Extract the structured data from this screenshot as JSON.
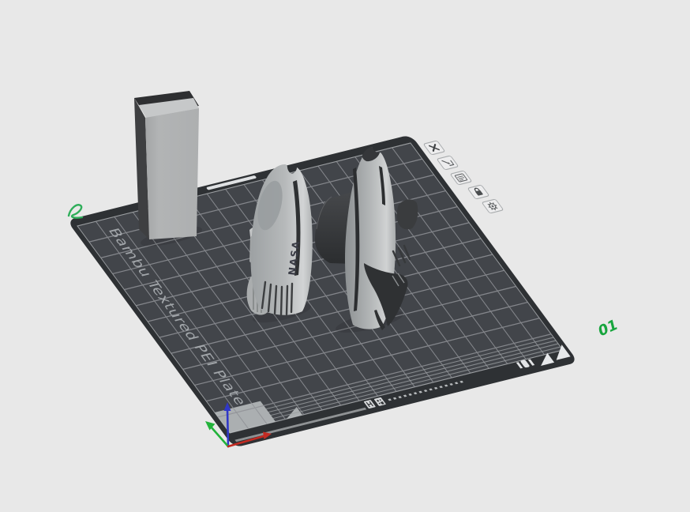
{
  "scene": {
    "type": "slicer-3d-plater-view",
    "background_color": "#e8e8e8"
  },
  "plate": {
    "label": "Bambu Textured PEI Plate",
    "number": "01",
    "grid": {
      "cols": 18,
      "rows": 13
    },
    "colors": {
      "surface": "#42454a",
      "grid_line": "#8f9296",
      "rim": "#2e3134",
      "label_text": "#a8acb0",
      "number_text": "#17a53d",
      "corner_marker": "#c6c9cb"
    }
  },
  "plate_toolbar": {
    "items": [
      {
        "id": "delete-plate",
        "icon": "close-x-icon"
      },
      {
        "id": "arrange-plate",
        "icon": "arrange-arrow-icon"
      },
      {
        "id": "rename-plate",
        "icon": "name-card-icon"
      },
      {
        "id": "lock-plate",
        "icon": "padlock-locked-icon"
      },
      {
        "id": "plate-settings",
        "icon": "gear-icon"
      }
    ]
  },
  "models": [
    {
      "id": "rectangular-block"
    },
    {
      "id": "rocket-half-shell-left",
      "decal": "NASA"
    },
    {
      "id": "rocket-half-shell-right"
    }
  ],
  "axes_indicator": {
    "x_color": "#c22a22",
    "y_color": "#22b23a",
    "z_color": "#3038c8"
  },
  "paint_cursor": {
    "color": "#2fae5a"
  }
}
